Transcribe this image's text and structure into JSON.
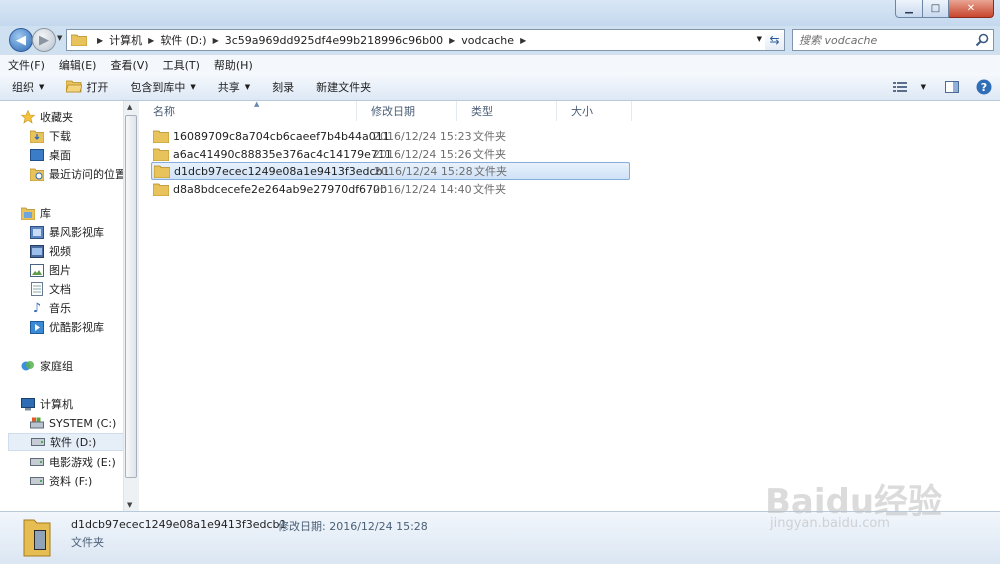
{
  "address": {
    "breadcrumbs": [
      "计算机",
      "软件 (D:)",
      "3c59a969dd925df4e99b218996c96b00",
      "vodcache"
    ]
  },
  "search": {
    "placeholder": "搜索 vodcache"
  },
  "menu": [
    "文件(F)",
    "编辑(E)",
    "查看(V)",
    "工具(T)",
    "帮助(H)"
  ],
  "toolbar": {
    "organize": "组织",
    "open": "打开",
    "include_library": "包含到库中",
    "share": "共享",
    "burn": "刻录",
    "new_folder": "新建文件夹"
  },
  "sidebar": {
    "favorites": {
      "label": "收藏夹",
      "items": [
        "下载",
        "桌面",
        "最近访问的位置"
      ]
    },
    "libraries": {
      "label": "库",
      "items": [
        "暴风影视库",
        "视频",
        "图片",
        "文档",
        "音乐",
        "优酷影视库"
      ]
    },
    "homegroup": "家庭组",
    "computer": {
      "label": "计算机",
      "items": [
        "SYSTEM (C:)",
        "软件 (D:)",
        "电影游戏 (E:)",
        "资料 (F:)"
      ]
    }
  },
  "columns": [
    "名称",
    "修改日期",
    "类型",
    "大小"
  ],
  "files": [
    {
      "name": "16089709c8a704cb6caeef7b4b44a011",
      "date": "2016/12/24 15:23",
      "type": "文件夹"
    },
    {
      "name": "a6ac41490c88835e376ac4c14179e711",
      "date": "2016/12/24 15:26",
      "type": "文件夹"
    },
    {
      "name": "d1dcb97ecec1249e08a1e9413f3edcb1",
      "date": "2016/12/24 15:28",
      "type": "文件夹"
    },
    {
      "name": "d8a8bdcecefe2e264ab9e27970df670b",
      "date": "2016/12/24 14:40",
      "type": "文件夹"
    }
  ],
  "details": {
    "name": "d1dcb97ecec1249e08a1e9413f3edcb1",
    "meta": "修改日期: 2016/12/24 15:28",
    "type": "文件夹"
  },
  "watermark": {
    "text": "Baidu经验",
    "url": "jingyan.baidu.com"
  }
}
